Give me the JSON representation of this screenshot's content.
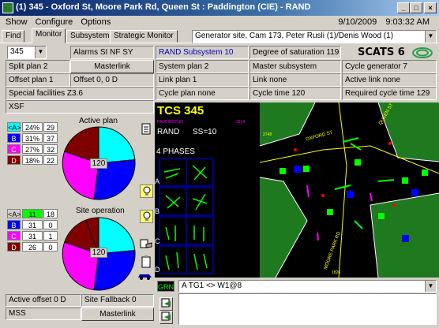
{
  "window": {
    "title": "(1)  345 - Oxford St, Moore Park Rd, Queen St : Paddington (CIE) - RAND",
    "minimize": "_",
    "maximize": "□",
    "close": "×"
  },
  "menu": {
    "items": [
      "Show",
      "Configure",
      "Options"
    ],
    "date": "9/10/2009",
    "time": "9:03:32 AM"
  },
  "tabs": [
    "Find",
    "Monitor",
    "Subsystem",
    "Strategic Monitor"
  ],
  "generator_combo": "Generator site, Cam 173, Peter Rusli (1)/Denis Wood (1)",
  "site_combo": "345",
  "left_fields": {
    "alarms": "Alarms SI NF SY",
    "split_plan": "Split plan 2",
    "masterlink": "Masterlink",
    "offset_plan": "Offset plan 1",
    "offset": "Offset 0, 0 D",
    "special_facilities": "Special facilities Z3.6",
    "xsf": "XSF"
  },
  "mid_fields": {
    "rand_subsystem": "RAND Subsystem 10",
    "system_plan": "System plan 2",
    "link_plan": "Link plan 1",
    "cycle_plan": "Cycle plan none",
    "degree_saturation": "Degree of saturation 119",
    "master_subsystem": "Master subsystem",
    "link_none": "Link none",
    "cycle_time": "Cycle time 120"
  },
  "right_fields": {
    "scats_logo": "SCATS 6",
    "cycle_generator": "Cycle generator   7",
    "active_link": "Active link none",
    "required_cycle": "Required cycle time 129"
  },
  "active_plan": {
    "title": "Active plan",
    "center": "120",
    "rows": [
      {
        "label": "<A>",
        "pct": "24%",
        "num": "29",
        "color": "#00ffff"
      },
      {
        "label": "B",
        "pct": "31%",
        "num": "37",
        "color": "#0000ff"
      },
      {
        "label": "C",
        "pct": "27%",
        "num": "32",
        "color": "#ff00ff"
      },
      {
        "label": "D",
        "pct": "18%",
        "num": "22",
        "color": "#800000"
      }
    ]
  },
  "site_operation": {
    "title": "Site operation",
    "center": "120",
    "rows": [
      {
        "label": "<A>",
        "pct": "11",
        "num": "18",
        "color": "#00ffff",
        "pct_bg": "#00ff00"
      },
      {
        "label": "B",
        "pct": "31",
        "num": "0",
        "color": "#0000ff"
      },
      {
        "label": "C",
        "pct": "31",
        "num": "1",
        "color": "#ff00ff"
      },
      {
        "label": "D",
        "pct": "26",
        "num": "0",
        "color": "#800000"
      }
    ]
  },
  "tcs": {
    "title": "TCS 345",
    "sub1": "PADDINGTON",
    "sub2": "2614",
    "rand": "RAND",
    "ss": "SS=10",
    "phases": "4 PHASES",
    "phase_labels": [
      "A",
      "B",
      "C",
      "D"
    ],
    "street_oxford": "OXFORD ST",
    "street_queen": "QUEEN ST",
    "street_moore": "MOORE PARK RD",
    "num_2748": "2748",
    "num_1826": "1826"
  },
  "bottom": {
    "grn": "GRN",
    "command": "A TG1 <> W1@8",
    "active_offset": "Active offset 0 D",
    "site_fallback": "Site Fallback 0",
    "mss": "MSS",
    "masterlink": "Masterlink"
  }
}
